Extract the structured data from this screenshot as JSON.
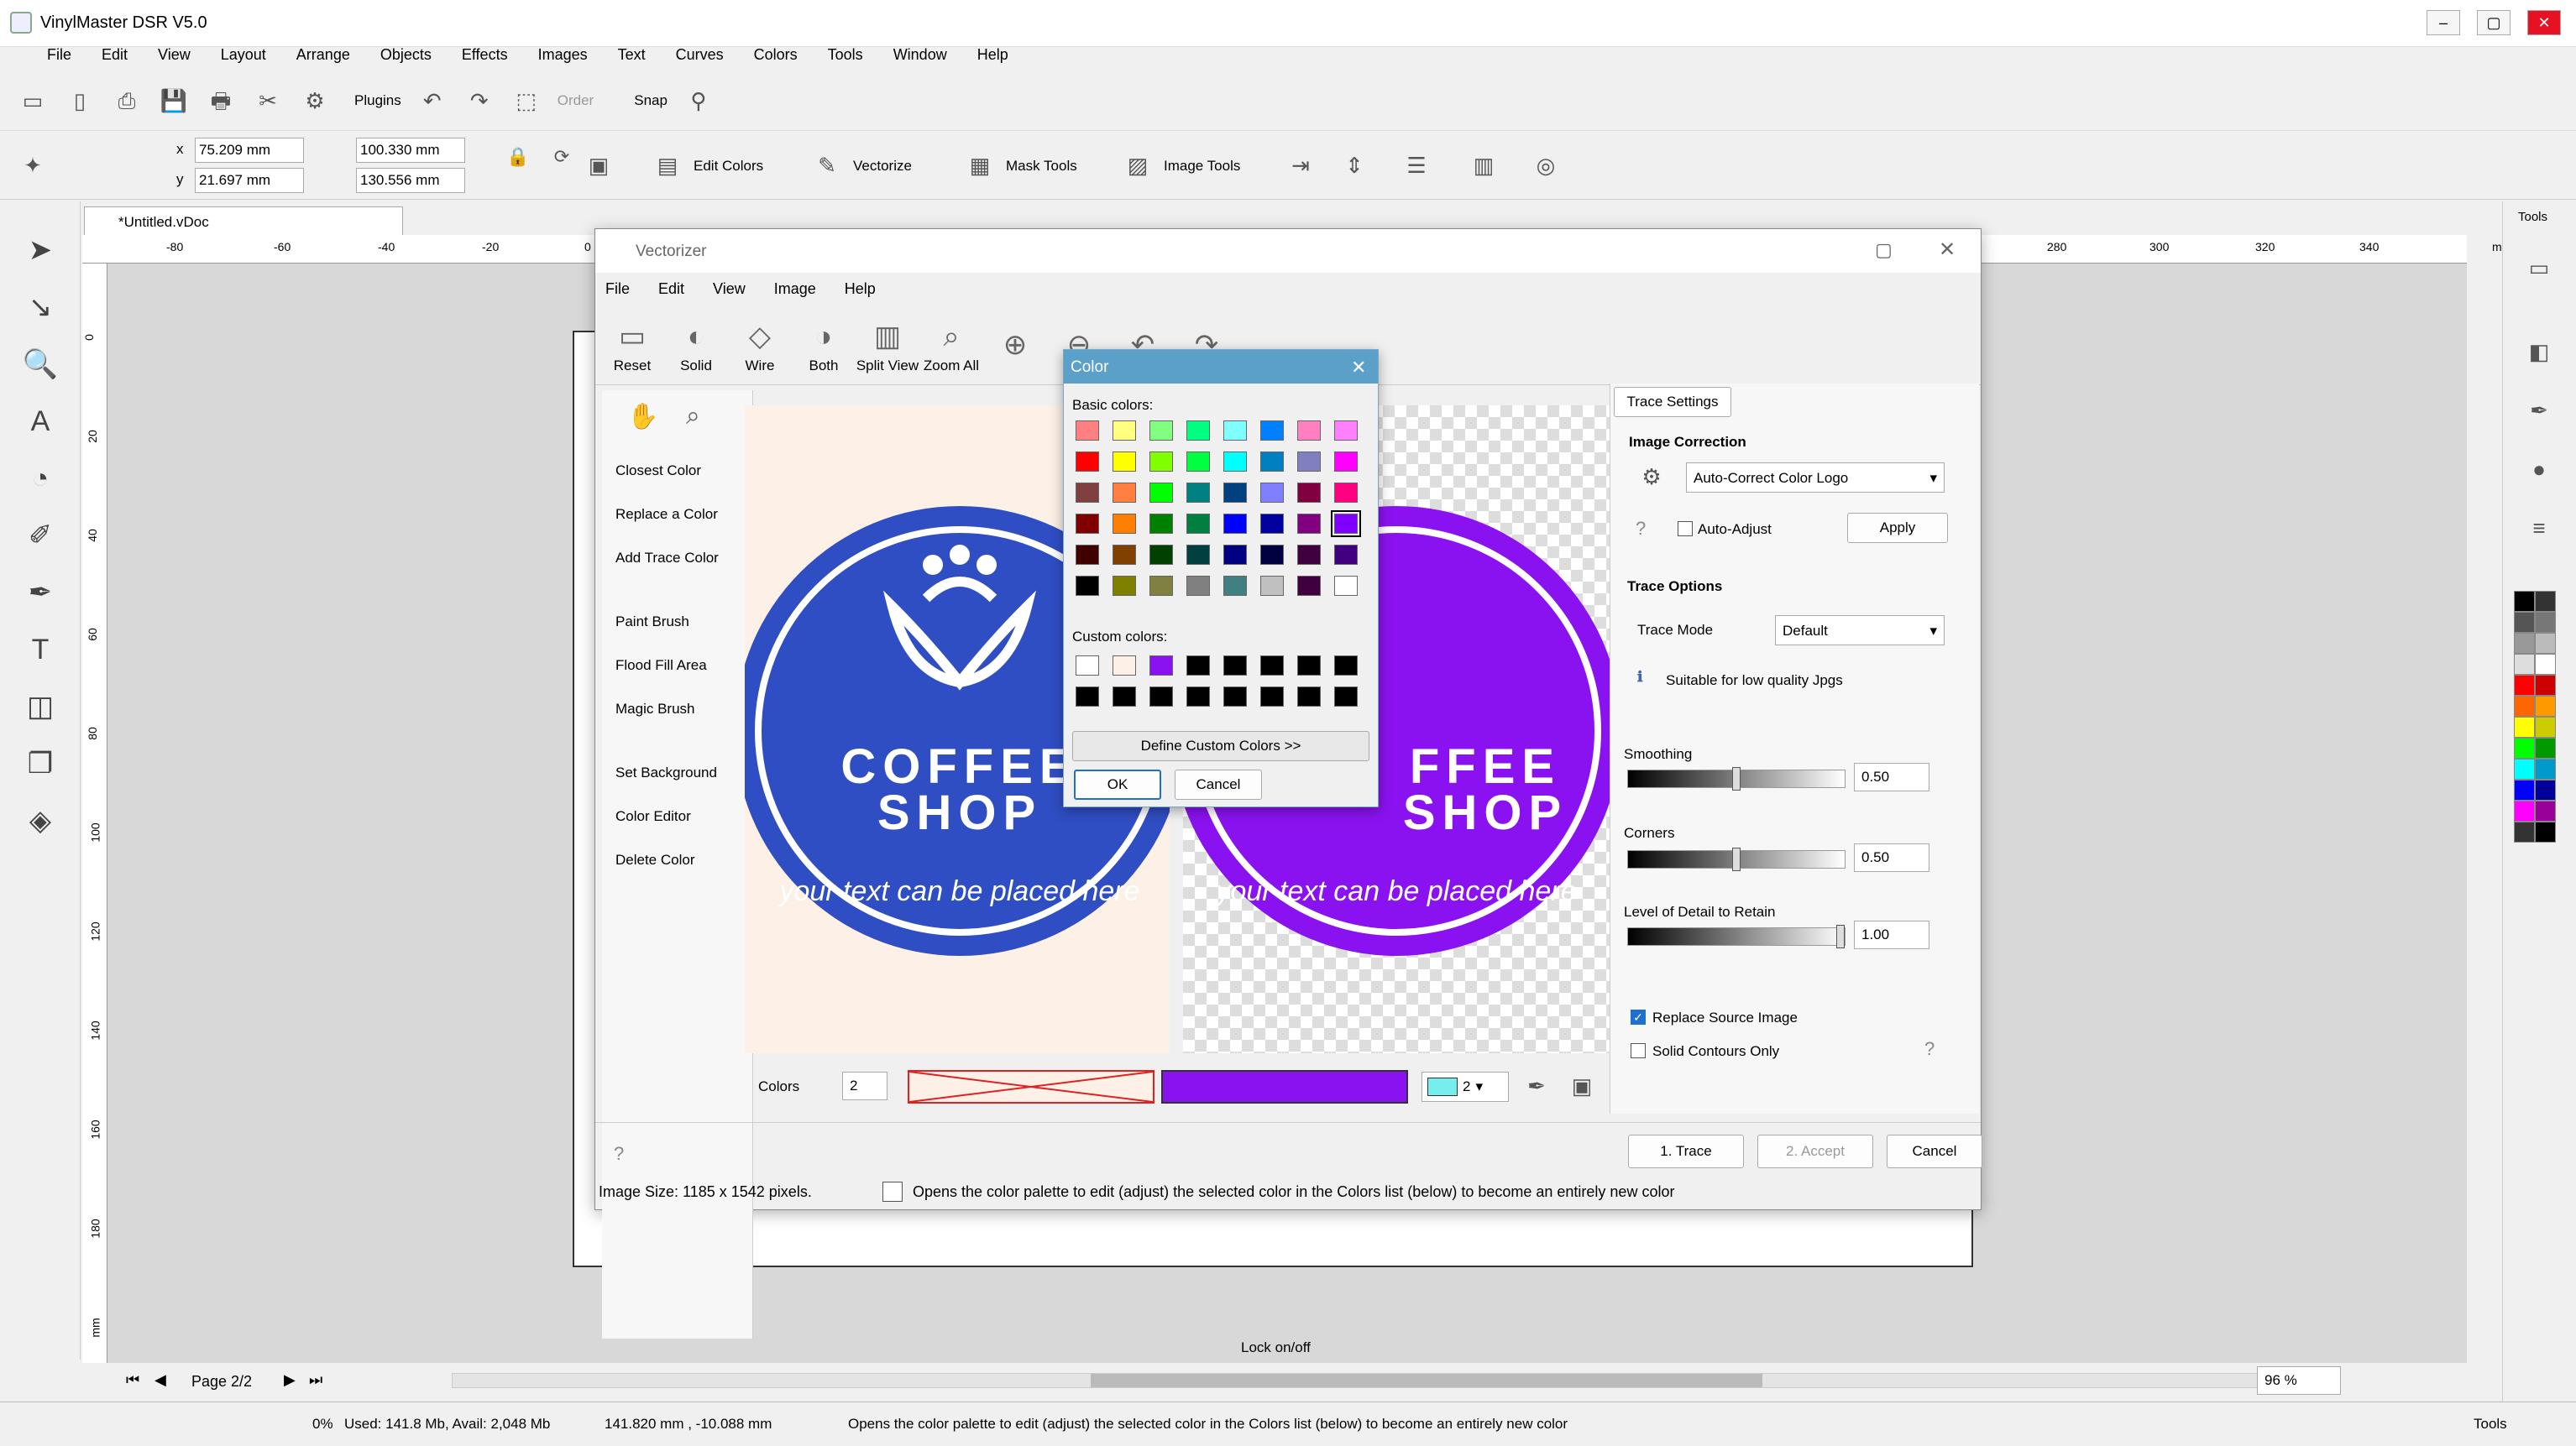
{
  "app": {
    "title": "VinylMaster DSR V5.0"
  },
  "menu": [
    "File",
    "Edit",
    "View",
    "Layout",
    "Arrange",
    "Objects",
    "Effects",
    "Images",
    "Text",
    "Curves",
    "Colors",
    "Tools",
    "Window",
    "Help"
  ],
  "toolbar1": {
    "plugins": "Plugins",
    "order": "Order",
    "snap": "Snap"
  },
  "toolbar2": {
    "x_label": "x",
    "x_value": "75.209 mm",
    "y_label": "y",
    "y_value": "21.697 mm",
    "w_value": "100.330 mm",
    "h_value": "130.556 mm",
    "edit_colors": "Edit Colors",
    "vectorize": "Vectorize",
    "mask_tools": "Mask Tools",
    "image_tools": "Image Tools"
  },
  "doc_tab": "*Untitled.vDoc",
  "ruler_h": [
    "-80",
    "-60",
    "-40",
    "-20",
    "0",
    "280",
    "300",
    "320",
    "340",
    "mm"
  ],
  "ruler_v": [
    "0",
    "20",
    "40",
    "60",
    "80",
    "100",
    "120",
    "140",
    "160",
    "180",
    "mm"
  ],
  "right_tools": {
    "label": "Tools"
  },
  "palette": [
    "#000000",
    "#333333",
    "#555555",
    "#777777",
    "#999999",
    "#bbbbbb",
    "#dddddd",
    "#ffffff",
    "#ff0000",
    "#cc0000",
    "#ff6600",
    "#ff9900",
    "#ffff00",
    "#cccc00",
    "#00ff00",
    "#009900",
    "#00ffff",
    "#0099cc",
    "#0000ff",
    "#000099",
    "#ff00ff",
    "#990099",
    "#333333",
    "#000000"
  ],
  "bottom": {
    "page": "Page 2/2",
    "lock": "Lock on/off",
    "zoom": "96 %"
  },
  "status": {
    "percent": "0%",
    "memory": "Used: 141.8 Mb, Avail: 2,048 Mb",
    "coords": "141.820 mm , -10.088 mm",
    "hint": "Opens the color palette to edit (adjust) the selected color in the Colors list (below) to become an entirely new color",
    "tools": "Tools"
  },
  "vectorizer": {
    "title": "Vectorizer",
    "menu": [
      "File",
      "Edit",
      "View",
      "Image",
      "Help"
    ],
    "toolbar": [
      "Reset",
      "Solid",
      "Wire",
      "Both",
      "Split View",
      "Zoom All"
    ],
    "side": [
      "Closest Color",
      "Replace a Color",
      "Add Trace Color",
      "Paint Brush",
      "Flood Fill Area",
      "Magic Brush",
      "Set Background",
      "Color Editor",
      "Delete Color"
    ],
    "logo": {
      "line1": "COFFEE",
      "line2": "SHOP",
      "curve": "your text can be placed here",
      "line1_partial": "FFEE",
      "line2_partial": "SHOP"
    },
    "colors_label": "Colors",
    "colors_count": "2",
    "swatch_count": "2",
    "accent_left": "#2f4ec4",
    "accent_right": "#8a12f0",
    "trace": {
      "tab": "Trace Settings",
      "image_correction": "Image Correction",
      "correction_value": "Auto-Correct Color Logo",
      "auto_adjust": "Auto-Adjust",
      "apply": "Apply",
      "trace_options": "Trace Options",
      "trace_mode": "Trace Mode",
      "trace_mode_value": "Default",
      "hint": "Suitable for low quality Jpgs",
      "smoothing": "Smoothing",
      "smoothing_value": "0.50",
      "smoothing_level": 0.5,
      "corners": "Corners",
      "corners_value": "0.50",
      "corners_level": 0.5,
      "detail": "Level of Detail to Retain",
      "detail_value": "1.00",
      "detail_level": 1.0,
      "replace_source": "Replace Source Image",
      "solid_contours": "Solid Contours Only"
    },
    "buttons": {
      "trace": "1. Trace",
      "accept": "2. Accept",
      "cancel": "Cancel"
    },
    "status": {
      "size": "Image Size: 1185 x 1542 pixels.",
      "hint": "Opens the color palette to edit (adjust) the selected color in the Colors list (below) to become an entirely new color"
    }
  },
  "color_dialog": {
    "title": "Color",
    "basic": "Basic colors:",
    "custom": "Custom colors:",
    "define": "Define Custom Colors >>",
    "ok": "OK",
    "cancel": "Cancel",
    "basic_colors": [
      "#ff8080",
      "#ffff80",
      "#80ff80",
      "#00ff80",
      "#80ffff",
      "#0080ff",
      "#ff80c0",
      "#ff80ff",
      "#ff0000",
      "#ffff00",
      "#80ff00",
      "#00ff40",
      "#00ffff",
      "#0080c0",
      "#8080c0",
      "#ff00ff",
      "#804040",
      "#ff8040",
      "#00ff00",
      "#008080",
      "#004080",
      "#8080ff",
      "#800040",
      "#ff0080",
      "#800000",
      "#ff8000",
      "#008000",
      "#008040",
      "#0000ff",
      "#0000a0",
      "#800080",
      "#8000ff",
      "#400000",
      "#804000",
      "#004000",
      "#004040",
      "#000080",
      "#000040",
      "#400040",
      "#400080",
      "#000000",
      "#808000",
      "#808040",
      "#808080",
      "#408080",
      "#c0c0c0",
      "#400040",
      "#ffffff"
    ],
    "custom_colors": [
      "#ffffff",
      "#fdf0e6",
      "#8a12f0",
      "#000000",
      "#000000",
      "#000000",
      "#000000",
      "#000000",
      "#000000",
      "#000000",
      "#000000",
      "#000000",
      "#000000",
      "#000000",
      "#000000",
      "#000000"
    ]
  }
}
